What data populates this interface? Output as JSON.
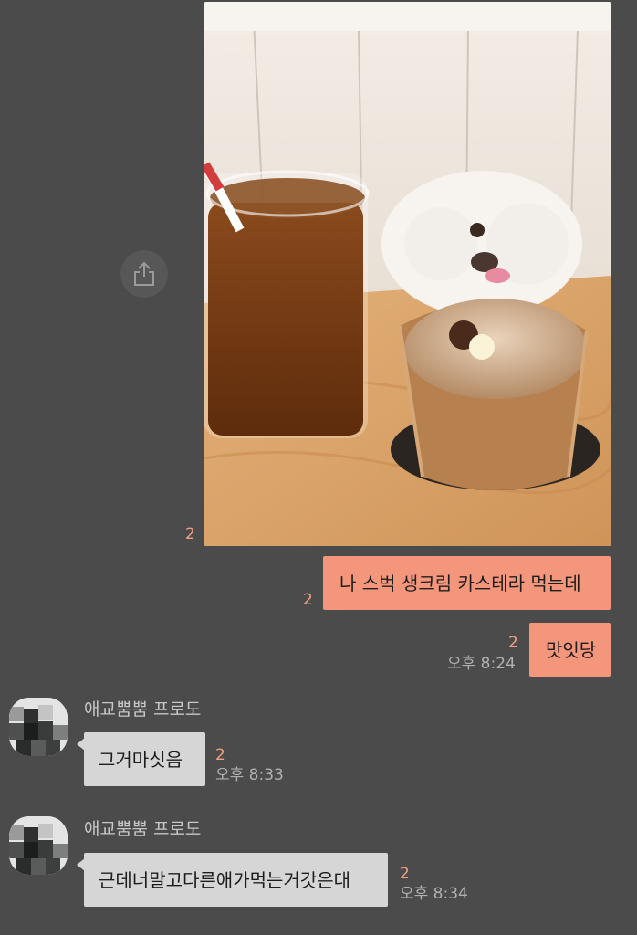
{
  "photo_message": {
    "unread_count": "2",
    "image_desc_icon": "photo-of-iced-tea-castella-and-dog"
  },
  "share": {
    "icon": "share-icon"
  },
  "my_messages": [
    {
      "text": "나 스벅 생크림 카스테라 먹는데",
      "unread": "2",
      "time": ""
    },
    {
      "text": "맛잇당",
      "unread": "2",
      "time": "오후 8:24"
    }
  ],
  "other_messages": [
    {
      "sender": "애교뿜뿜 프로도",
      "text": "그거마싯음",
      "unread": "2",
      "time": "오후 8:33"
    },
    {
      "sender": "애교뿜뿜 프로도",
      "text": "근데너말고다른애가먹는거갓은대",
      "unread": "2",
      "time": "오후 8:34"
    }
  ],
  "colors": {
    "background": "#4b4b4b",
    "my_bubble": "#f3967b",
    "other_bubble": "#d6d6d6",
    "unread": "#f0a080",
    "time": "#b0b0b0"
  }
}
